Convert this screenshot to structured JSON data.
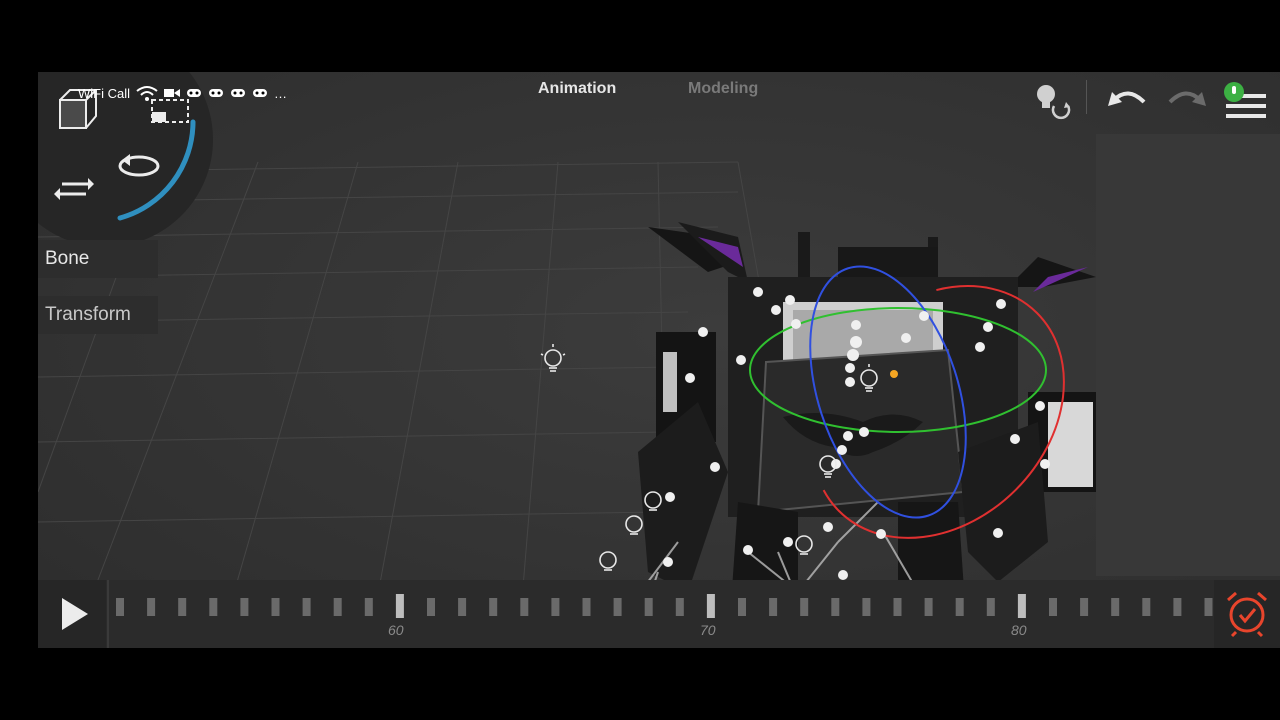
{
  "status_bar": {
    "wifi_call_label": "WiFi Call",
    "more_indicator": "…"
  },
  "mode_tabs": [
    {
      "label": "Animation",
      "active": true
    },
    {
      "label": "Modeling",
      "active": false
    }
  ],
  "left_panel": {
    "bone_label": "Bone",
    "transform_label": "Transform"
  },
  "toolbar": {
    "icons": [
      "light-toggle-icon",
      "undo-icon",
      "redo-icon",
      "menu-icon",
      "microphone-indicator-icon"
    ]
  },
  "timeline": {
    "frame_labels": [
      "60",
      "70",
      "80"
    ],
    "play_icon": "play-icon",
    "autokey_icon": "alarm-clock-icon"
  },
  "colors": {
    "background": "#333333",
    "accent_blue": "#2f8fbf",
    "gizmo_red": "#e03030",
    "gizmo_green": "#30c030",
    "gizmo_blue": "#3050e0",
    "alarm_red": "#e8452c",
    "mic_green": "#3cb043"
  }
}
